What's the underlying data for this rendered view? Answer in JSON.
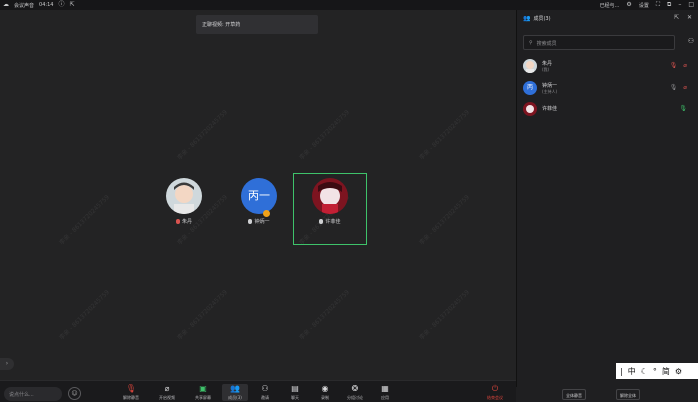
{
  "titlebar": {
    "app_name": "会议声音",
    "time": "04:14",
    "account": "已经与...",
    "settings": "设置"
  },
  "toast": {
    "text": "正聊视频: 开草药"
  },
  "participants_stage": [
    {
      "name": "朱丹",
      "avatar_type": "photo-boy"
    },
    {
      "name": "钟炳一",
      "avatar_text": "丙一",
      "avatar_color": "#2f6fd8"
    },
    {
      "name": "许菲佳",
      "avatar_type": "photo-girl"
    }
  ],
  "watermark_text": "李亲 - 8613720245759",
  "toolbar": {
    "chat_placeholder": "说点什么...",
    "tools": [
      {
        "label": "解除静音",
        "icon": "mic-muted-icon"
      },
      {
        "label": "开启视频",
        "icon": "camera-off-icon"
      },
      {
        "label": "共享屏幕",
        "icon": "screen-share-icon"
      },
      {
        "label": "成员(3)",
        "icon": "members-icon"
      },
      {
        "label": "邀请",
        "icon": "invite-icon"
      },
      {
        "label": "聊天",
        "icon": "chat-icon"
      },
      {
        "label": "录制",
        "icon": "record-icon"
      },
      {
        "label": "分组讨论",
        "icon": "breakout-icon"
      },
      {
        "label": "应用",
        "icon": "apps-icon"
      }
    ],
    "leave_label": "结束会议"
  },
  "sidebar": {
    "title": "成员(3)",
    "search_placeholder": "搜索成员",
    "members": [
      {
        "name": "朱丹",
        "role": "(我)",
        "mic_color": "#d9534f"
      },
      {
        "name": "钟炳一",
        "role": "(主持人)",
        "avatar_text": "丙",
        "mic_color": "#8e8e91"
      },
      {
        "name": "许菲佳",
        "role": "",
        "mic_color": "#3ec26a"
      }
    ],
    "footer_buttons": [
      "全体静音",
      "解除全体"
    ],
    "ime": [
      "中",
      "简"
    ]
  },
  "colors": {
    "active_speaker": "#3ec26a",
    "leave": "#e0463d"
  }
}
